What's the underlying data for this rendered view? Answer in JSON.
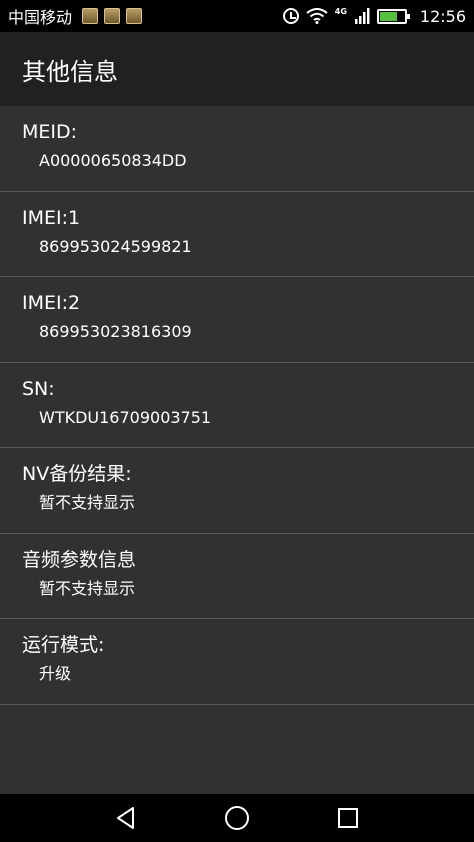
{
  "status_bar": {
    "carrier": "中国移动",
    "network_type": "4G",
    "time": "12:56",
    "battery_level_fraction": 0.7,
    "icons": [
      "notification-app-icon",
      "notification-app-icon",
      "notification-app-icon",
      "alarm-icon",
      "wifi-icon",
      "signal-icon",
      "battery-icon"
    ]
  },
  "app_bar": {
    "title": "其他信息"
  },
  "items": [
    {
      "label": "MEID:",
      "value": "A00000650834DD"
    },
    {
      "label": "IMEI:1",
      "value": "869953024599821"
    },
    {
      "label": "IMEI:2",
      "value": "869953023816309"
    },
    {
      "label": "SN:",
      "value": "WTKDU16709003751"
    },
    {
      "label": "NV备份结果:",
      "value": "暂不支持显示"
    },
    {
      "label": "音频参数信息",
      "value": "暂不支持显示"
    },
    {
      "label": "运行模式:",
      "value": "升级"
    }
  ],
  "nav_bar": {
    "buttons": [
      "back-icon",
      "home-icon",
      "recents-icon"
    ]
  },
  "colors": {
    "background": "#313131",
    "app_bar": "#212121",
    "divider": "#5a5a5a",
    "battery": "#55c040"
  }
}
